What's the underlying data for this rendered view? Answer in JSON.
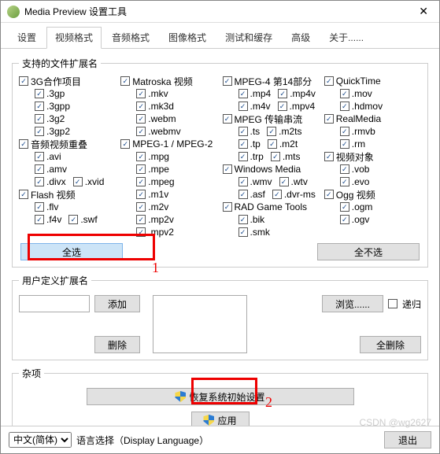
{
  "title": "Media Preview 设置工具",
  "tabs": [
    "设置",
    "视频格式",
    "音频格式",
    "图像格式",
    "测试和缓存",
    "高级",
    "关于......"
  ],
  "activeTab": 1,
  "group": {
    "supported": "支持的文件扩展名",
    "userext": "用户定义扩展名",
    "misc": "杂项"
  },
  "cols": [
    [
      {
        "l": "3G合作项目",
        "p": 0
      },
      {
        "l": ".3gp",
        "p": 1
      },
      {
        "l": ".3gpp",
        "p": 1
      },
      {
        "l": ".3g2",
        "p": 1
      },
      {
        "l": ".3gp2",
        "p": 1
      },
      {
        "l": "音频视频重叠",
        "p": 0
      },
      {
        "l": ".avi",
        "p": 1
      },
      {
        "l": ".amv",
        "p": 1
      },
      {
        "l": ".divx",
        "p": 1,
        "extra": ".xvid"
      },
      {
        "l": "Flash 视频",
        "p": 0
      },
      {
        "l": ".flv",
        "p": 1
      },
      {
        "l": ".f4v",
        "p": 1,
        "extra": ".swf"
      }
    ],
    [
      {
        "l": "Matroska 视频",
        "p": 0
      },
      {
        "l": ".mkv",
        "p": 1
      },
      {
        "l": ".mk3d",
        "p": 1
      },
      {
        "l": ".webm",
        "p": 1
      },
      {
        "l": ".webmv",
        "p": 1
      },
      {
        "l": "MPEG-1 / MPEG-2",
        "p": 0
      },
      {
        "l": ".mpg",
        "p": 1
      },
      {
        "l": ".mpe",
        "p": 1
      },
      {
        "l": ".mpeg",
        "p": 1
      },
      {
        "l": ".m1v",
        "p": 1
      },
      {
        "l": ".m2v",
        "p": 1
      },
      {
        "l": ".mp2v",
        "p": 1
      },
      {
        "l": ".mpv2",
        "p": 1
      }
    ],
    [
      {
        "l": "MPEG-4 第14部分",
        "p": 0
      },
      {
        "l": ".mp4",
        "p": 1,
        "extra": ".mp4v"
      },
      {
        "l": ".m4v",
        "p": 1,
        "extra": ".mpv4"
      },
      {
        "l": "MPEG 传输串流",
        "p": 0
      },
      {
        "l": ".ts",
        "p": 1,
        "extra": ".m2ts"
      },
      {
        "l": ".tp",
        "p": 1,
        "extra": ".m2t"
      },
      {
        "l": ".trp",
        "p": 1,
        "extra": ".mts"
      },
      {
        "l": "Windows Media",
        "p": 0
      },
      {
        "l": ".wmv",
        "p": 1,
        "extra": ".wtv"
      },
      {
        "l": ".asf",
        "p": 1,
        "extra": ".dvr-ms"
      },
      {
        "l": "RAD Game Tools",
        "p": 0
      },
      {
        "l": ".bik",
        "p": 1
      },
      {
        "l": ".smk",
        "p": 1
      }
    ],
    [
      {
        "l": "QuickTime",
        "p": 0
      },
      {
        "l": ".mov",
        "p": 1
      },
      {
        "l": ".hdmov",
        "p": 1
      },
      {
        "l": "RealMedia",
        "p": 0
      },
      {
        "l": ".rmvb",
        "p": 1
      },
      {
        "l": ".rm",
        "p": 1
      },
      {
        "l": "视频对象",
        "p": 0
      },
      {
        "l": ".vob",
        "p": 1
      },
      {
        "l": ".evo",
        "p": 1
      },
      {
        "l": "Ogg 视频",
        "p": 0
      },
      {
        "l": ".ogm",
        "p": 1
      },
      {
        "l": ".ogv",
        "p": 1
      }
    ]
  ],
  "buttons": {
    "selectAll": "全选",
    "selectNone": "全不选",
    "add": "添加",
    "delete": "删除",
    "browse": "浏览......",
    "recursive": "递归",
    "deleteAll": "全删除",
    "restore": "恢复系统初始设置",
    "apply": "应用",
    "exit": "退出"
  },
  "lang": {
    "selected": "中文(简体)",
    "label": "语言选择（Display Language）"
  },
  "annot": {
    "one": "1",
    "two": "2"
  },
  "watermark": "CSDN @wg2627"
}
